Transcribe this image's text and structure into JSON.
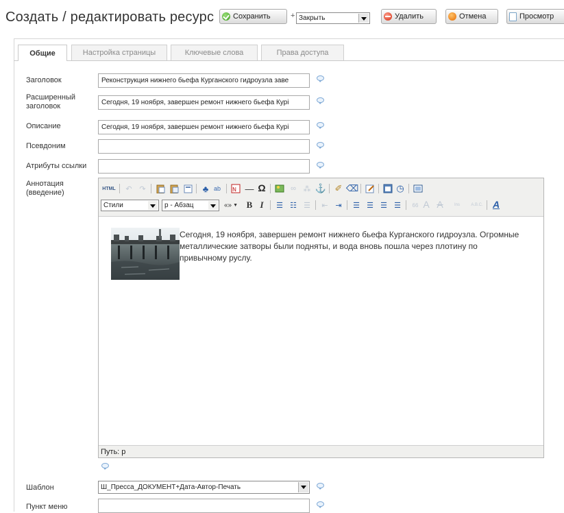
{
  "header": {
    "title": "Создать / редактировать ресурс",
    "save_label": "Сохранить",
    "plus": "+",
    "after_save_value": "Закрыть",
    "delete_label": "Удалить",
    "cancel_label": "Отмена",
    "preview_label": "Просмотр"
  },
  "tabs": [
    {
      "label": "Общие",
      "active": true
    },
    {
      "label": "Настройка страницы",
      "active": false
    },
    {
      "label": "Ключевые слова",
      "active": false
    },
    {
      "label": "Права доступа",
      "active": false
    }
  ],
  "fields": {
    "title": {
      "label": "Заголовок",
      "value": "Реконструкция нижнего бьефа Курганского гидроузла заве"
    },
    "longtitle": {
      "label": "Расширенный заголовок",
      "label_line1": "Расширенный",
      "label_line2": "заголовок",
      "value": "Сегодня, 19 ноября, завершен ремонт нижнего бьефа Курі"
    },
    "description": {
      "label": "Описание",
      "value": "Сегодня, 19 ноября, завершен ремонт нижнего бьефа Курі"
    },
    "alias": {
      "label": "Псевдоним",
      "value": ""
    },
    "link_attributes": {
      "label": "Атрибуты ссылки",
      "value": ""
    },
    "introtext": {
      "label_line1": "Аннотация",
      "label_line2": "(введение)"
    },
    "template": {
      "label": "Шаблон",
      "value": "Ш_Пресса_ДОКУМЕНТ+Дата-Автор-Печать"
    },
    "menu_item": {
      "label": "Пункт меню",
      "value": ""
    }
  },
  "editor": {
    "style_select": "Стили",
    "format_select": "p - Абзац",
    "content": "Сегодня, 19 ноября, завершен ремонт нижнего бьефа Курганского гидроузла. Огромные металлические затворы были подняты, и вода вновь пошла через плотину по привычному руслу.",
    "path_label": "Путь: p",
    "html_button": "HTML",
    "fontsize_label": "«»",
    "bold_label": "B",
    "italic_label": "I",
    "omega_label": "Ω",
    "insert_label": "Ins"
  },
  "colors": {
    "accent_green": "#3a9a1c",
    "accent_red": "#d22b10",
    "accent_orange": "#e56a00",
    "help_icon": "#7fa9d6"
  }
}
